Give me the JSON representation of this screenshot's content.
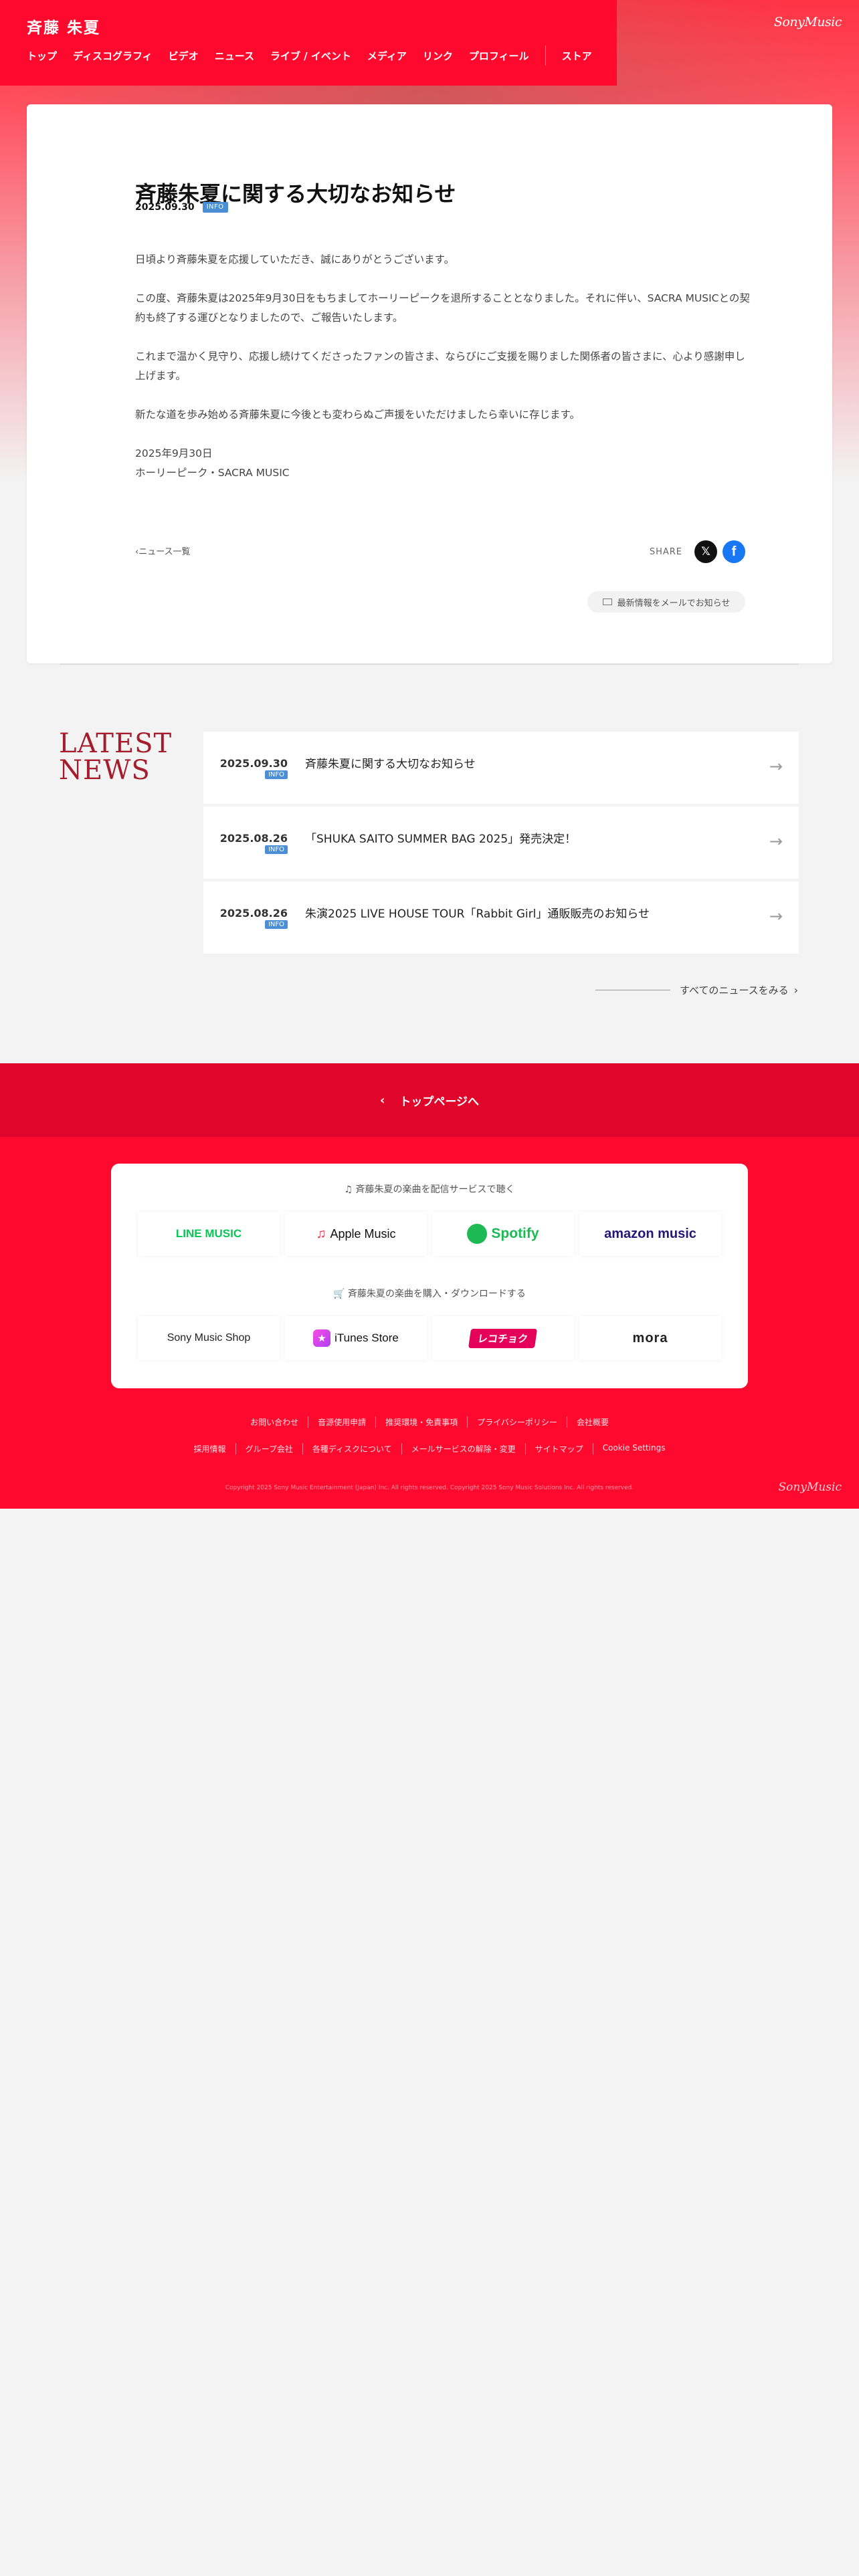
{
  "header": {
    "site_title": "斉藤 朱夏",
    "brand": "SonyMusic",
    "nav": [
      "トップ",
      "ディスコグラフィ",
      "ビデオ",
      "ニュース",
      "ライブ / イベント",
      "メディア",
      "リンク",
      "プロフィール"
    ],
    "store": "ストア"
  },
  "article": {
    "title": "斉藤朱夏に関する大切なお知らせ",
    "date": "2025.09.30",
    "category": "INFO",
    "paragraphs": [
      "日頃より斉藤朱夏を応援していただき、誠にありがとうございます。",
      "この度、斉藤朱夏は2025年9月30日をもちましてホーリーピークを退所することとなりました。それに伴い、SACRA MUSICとの契約も終了する運びとなりましたので、ご報告いたします。",
      "これまで温かく見守り、応援し続けてくださったファンの皆さま、ならびにご支援を賜りました関係者の皆さまに、心より感謝申し上げます。",
      "新たな道を歩み始める斉藤朱夏に今後とも変わらぬご声援をいただけましたら幸いに存じます。"
    ],
    "sign_date": "2025年9月30日",
    "sign_org": "ホーリーピーク・SACRA MUSIC",
    "back_label": "ニュース一覧",
    "share_label": "SHARE",
    "mail_label": "最新情報をメールでお知らせ"
  },
  "latest_news": {
    "heading_line1": "LATEST",
    "heading_line2": "NEWS",
    "items": [
      {
        "date": "2025.09.30",
        "category": "INFO",
        "title": "斉藤朱夏に関する大切なお知らせ"
      },
      {
        "date": "2025.08.26",
        "category": "INFO",
        "title": "「SHUKA SAITO SUMMER BAG 2025」発売決定！"
      },
      {
        "date": "2025.08.26",
        "category": "INFO",
        "title": "朱演2025 LIVE HOUSE TOUR「Rabbit Girl」通販販売のお知らせ"
      }
    ],
    "all_label": "すべてのニュースをみる"
  },
  "footer": {
    "top_label": "トップページへ",
    "streaming_heading": "斉藤朱夏の楽曲を配信サービスで聴く",
    "streaming": [
      "LINE MUSIC",
      "Apple Music",
      "Spotify",
      "amazon music"
    ],
    "purchase_heading": "斉藤朱夏の楽曲を購入・ダウンロードする",
    "purchase": [
      "Sony Music Shop",
      "iTunes Store",
      "レコチョク",
      "mora"
    ],
    "links_row1": [
      "お問い合わせ",
      "音源使用申請",
      "推奨環境・免責事項",
      "プライバシーポリシー",
      "会社概要"
    ],
    "links_row2": [
      "採用情報",
      "グループ会社",
      "各種ディスクについて",
      "メールサービスの解除・変更",
      "サイトマップ",
      "Cookie Settings"
    ],
    "copyright": "Copyright 2025 Sony Music Entertainment (Japan) Inc. All rights reserved. Copyright 2025 Sony Music Solutions Inc. All rights reserved.",
    "brand": "SonyMusic"
  },
  "colors": {
    "brand_red": "#ff0a2e",
    "band_red": "#e0052a",
    "info_badge": "#4a8fd6",
    "latest_red": "#a51c2c"
  }
}
